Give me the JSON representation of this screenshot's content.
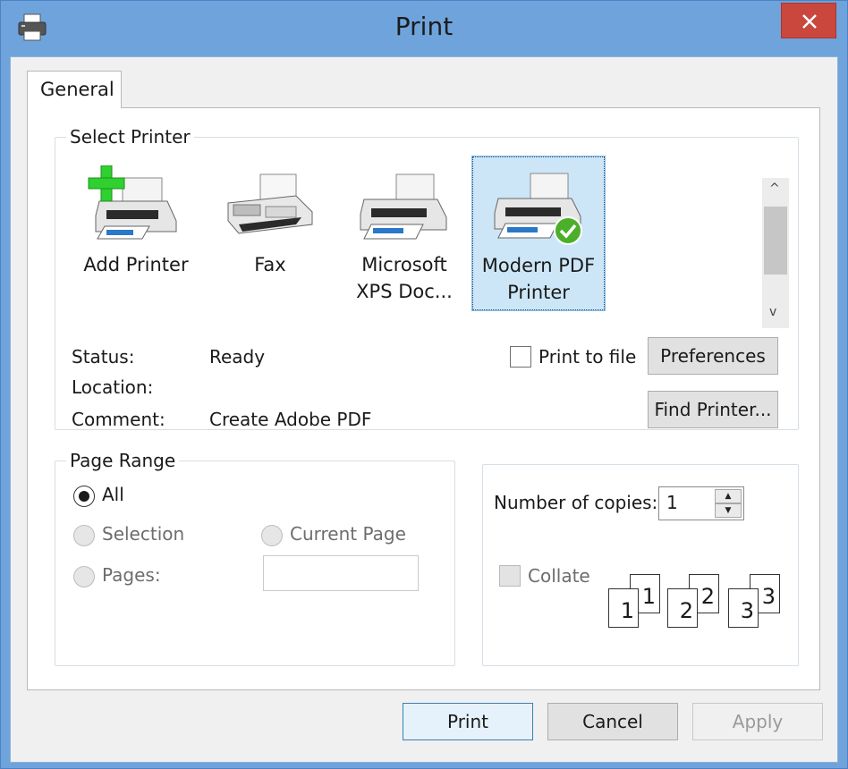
{
  "window": {
    "title": "Print",
    "close_glyph": "✕"
  },
  "tabs": [
    {
      "label": "General"
    }
  ],
  "select_printer": {
    "legend": "Select Printer",
    "printers": [
      {
        "line1": "Add Printer",
        "line2": "",
        "icon": "add-printer-icon",
        "selected": false
      },
      {
        "line1": "Fax",
        "line2": "",
        "icon": "fax-icon",
        "selected": false
      },
      {
        "line1": "Microsoft",
        "line2": "XPS Doc...",
        "icon": "printer-icon",
        "selected": false
      },
      {
        "line1": "Modern PDF",
        "line2": "Printer",
        "icon": "default-printer-icon",
        "selected": true
      }
    ],
    "scroll_up": "^",
    "scroll_down": "v",
    "status_label": "Status:",
    "status_value": "Ready",
    "location_label": "Location:",
    "location_value": "",
    "comment_label": "Comment:",
    "comment_value": "Create Adobe PDF",
    "print_to_file_label": "Print to file",
    "print_to_file_checked": false,
    "preferences_label": "Preferences",
    "find_printer_label": "Find Printer..."
  },
  "page_range": {
    "legend": "Page Range",
    "all_label": "All",
    "selection_label": "Selection",
    "current_page_label": "Current Page",
    "pages_label": "Pages:",
    "selected": "All",
    "pages_value": ""
  },
  "copies": {
    "number_label": "Number of copies:",
    "number_value": "1",
    "collate_label": "Collate",
    "collate_checked": false,
    "collate_pages": [
      "1",
      "1",
      "2",
      "2",
      "3",
      "3"
    ]
  },
  "buttons": {
    "print": "Print",
    "cancel": "Cancel",
    "apply": "Apply"
  },
  "colors": {
    "titlebar": "#6fa3dc",
    "close": "#c9473c",
    "selection": "#cce6f7",
    "checkmark": "#4caf2a",
    "add_plus": "#2fd02f"
  }
}
